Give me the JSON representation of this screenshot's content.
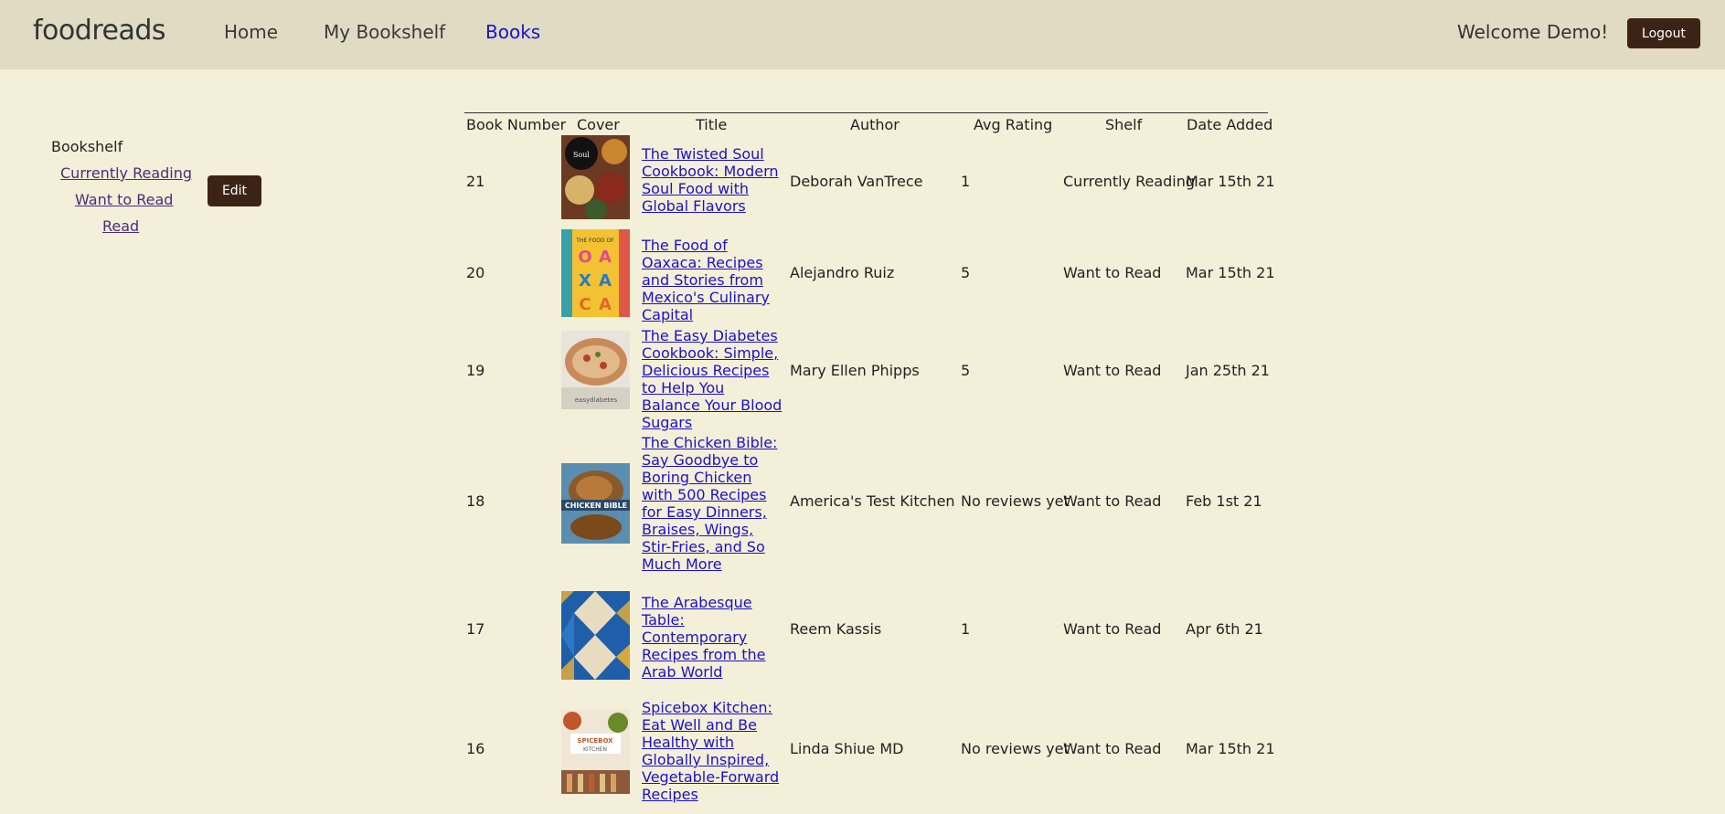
{
  "nav": {
    "logo": "foodreads",
    "links": [
      "Home",
      "My Bookshelf",
      "Books"
    ],
    "welcome": "Welcome Demo!",
    "logout": "Logout"
  },
  "sidebar": {
    "heading": "Bookshelf",
    "links": [
      "Currently Reading",
      "Want to Read",
      "Read"
    ],
    "edit": "Edit"
  },
  "table": {
    "headers": [
      "Book Number",
      "Cover",
      "Title",
      "Author",
      "Avg Rating",
      "Shelf",
      "Date Added"
    ],
    "rows": [
      {
        "number": "21",
        "title": "The Twisted Soul Cookbook: Modern Soul Food with Global Flavors",
        "author": "Deborah VanTrece",
        "rating": "1",
        "shelf": "Currently Reading",
        "date": "Mar 15th 21"
      },
      {
        "number": "20",
        "title": "The Food of Oaxaca: Recipes and Stories from Mexico's Culinary Capital",
        "author": "Alejandro Ruiz",
        "rating": "5",
        "shelf": "Want to Read",
        "date": "Mar 15th 21"
      },
      {
        "number": "19",
        "title": "The Easy Diabetes Cookbook: Simple, Delicious Recipes to Help You Balance Your Blood Sugars",
        "author": "Mary Ellen Phipps",
        "rating": "5",
        "shelf": "Want to Read",
        "date": "Jan 25th 21"
      },
      {
        "number": "18",
        "title": "The Chicken Bible: Say Goodbye to Boring Chicken with 500 Recipes for Easy Dinners, Braises, Wings, Stir-Fries, and So Much More",
        "author": "America's Test Kitchen",
        "rating": "No reviews yet",
        "shelf": "Want to Read",
        "date": "Feb 1st 21"
      },
      {
        "number": "17",
        "title": "The Arabesque Table: Contemporary Recipes from the Arab World",
        "author": "Reem Kassis",
        "rating": "1",
        "shelf": "Want to Read",
        "date": "Apr 6th 21"
      },
      {
        "number": "16",
        "title": "Spicebox Kitchen: Eat Well and Be Healthy with Globally Inspired, Vegetable-Forward Recipes",
        "author": "Linda Shiue MD",
        "rating": "No reviews yet",
        "shelf": "Want to Read",
        "date": "Mar 15th 21"
      }
    ]
  }
}
